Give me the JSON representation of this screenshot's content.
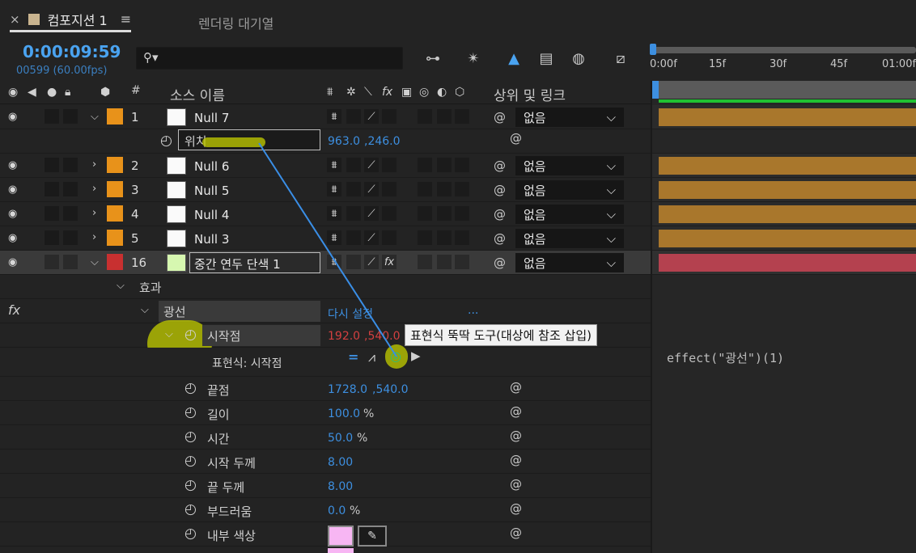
{
  "tabs": {
    "close": "×",
    "active": "컴포지션 1",
    "menu": "≡",
    "inactive": "렌더링 대기열"
  },
  "time": {
    "timecode": "0:00:09:59",
    "frames": "00599 (60.00fps)"
  },
  "search": {
    "icon": "search-icon"
  },
  "ruler": {
    "labels": [
      "0:00f",
      "15f",
      "30f",
      "45f",
      "01:00f"
    ]
  },
  "columns": {
    "hash": "#",
    "source_name": "소스 이름",
    "parent_link": "상위 및 링크"
  },
  "layers": [
    {
      "num": "1",
      "name": "Null 7",
      "label_color": "#e8921a",
      "parent": "없음",
      "expanded": true
    },
    {
      "num": "2",
      "name": "Null 6",
      "label_color": "#e8921a",
      "parent": "없음",
      "expanded": false
    },
    {
      "num": "3",
      "name": "Null 5",
      "label_color": "#e8921a",
      "parent": "없음",
      "expanded": false
    },
    {
      "num": "4",
      "name": "Null 4",
      "label_color": "#e8921a",
      "parent": "없음",
      "expanded": false
    },
    {
      "num": "5",
      "name": "Null 3",
      "label_color": "#e8921a",
      "parent": "없음",
      "expanded": false
    },
    {
      "num": "16",
      "name": "중간 연두 단색 1",
      "label_color": "#c83030",
      "parent": "없음",
      "expanded": true
    }
  ],
  "position_prop": {
    "label": "위치",
    "value_x": "963.0",
    "value_y": ",246.0"
  },
  "effects": {
    "group_label": "효과",
    "fx_label": "fx",
    "effect_name": "광선",
    "reset": "다시 설정",
    "more": "...",
    "start_point": {
      "label": "시작점",
      "x": "192.0",
      "y": ",540.0"
    },
    "expression_label": "표현식: 시작점",
    "expression_text": "effect(\"광선\")(1)",
    "properties": [
      {
        "label": "끝점",
        "value": "1728.0",
        "value2": ",540.0",
        "unit": ""
      },
      {
        "label": "길이",
        "value": "100.0",
        "value2": "",
        "unit": "%"
      },
      {
        "label": "시간",
        "value": "50.0",
        "value2": "",
        "unit": "%"
      },
      {
        "label": "시작 두께",
        "value": "8.00",
        "value2": "",
        "unit": ""
      },
      {
        "label": "끝 두께",
        "value": "8.00",
        "value2": "",
        "unit": ""
      },
      {
        "label": "부드러움",
        "value": "0.0",
        "value2": "",
        "unit": "%"
      },
      {
        "label": "내부 색상",
        "value": "",
        "value2": "",
        "unit": ""
      }
    ],
    "inner_color": "#f7b6f3"
  },
  "tooltip": "표현식 뚝딱 도구(대상에 참조 삽입)",
  "colors": {
    "accent_blue": "#3d8fe0",
    "track_orange": "#a9772c",
    "track_red": "#b4414f",
    "work_area_green": "#21c232"
  }
}
